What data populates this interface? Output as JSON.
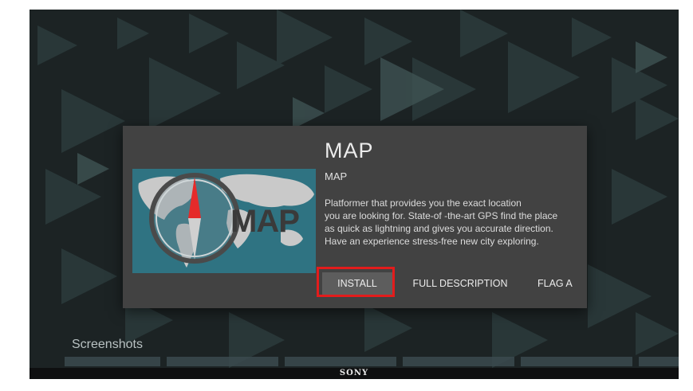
{
  "app": {
    "title": "MAP",
    "developer": "MAP",
    "image_text": "MAP",
    "description": [
      "Platformer that provides you the exact location",
      "you are looking for. State-of -the-art GPS find the place",
      "as quick as lightning and gives you accurate direction.",
      "Have an experience stress-free new city exploring."
    ]
  },
  "actions": {
    "install": "INSTALL",
    "full_description": "FULL DESCRIPTION",
    "flag": "FLAG A"
  },
  "section": {
    "screenshots_label": "Screenshots"
  },
  "tv": {
    "brand": "SONY"
  },
  "colors": {
    "dialog_bg": "#424242",
    "install_bg": "#5d5d5d",
    "highlight": "#e31c1c",
    "compass_needle": "#e52a2a",
    "map_bg": "#2f7382"
  },
  "icons": {
    "compass": "compass-icon",
    "play_triangles": "play-triangle-pattern"
  }
}
